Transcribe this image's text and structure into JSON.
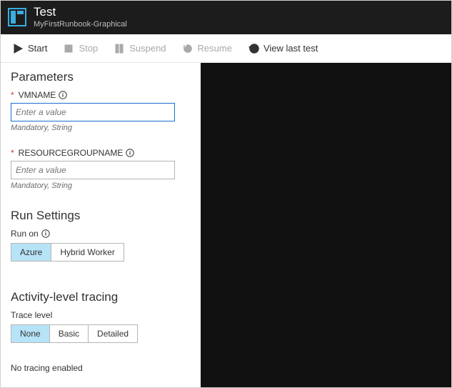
{
  "header": {
    "title": "Test",
    "subtitle": "MyFirstRunbook-Graphical"
  },
  "toolbar": {
    "start": "Start",
    "stop": "Stop",
    "suspend": "Suspend",
    "resume": "Resume",
    "view_last": "View last test"
  },
  "parameters": {
    "heading": "Parameters",
    "vmname": {
      "label": "VMNAME",
      "placeholder": "Enter a value",
      "hint": "Mandatory, String"
    },
    "rgname": {
      "label": "RESOURCEGROUPNAME",
      "placeholder": "Enter a value",
      "hint": "Mandatory, String"
    }
  },
  "run_settings": {
    "heading": "Run Settings",
    "label": "Run on",
    "options": {
      "azure": "Azure",
      "hybrid": "Hybrid Worker"
    },
    "selected": "azure"
  },
  "tracing": {
    "heading": "Activity-level tracing",
    "label": "Trace level",
    "options": {
      "none": "None",
      "basic": "Basic",
      "detailed": "Detailed"
    },
    "selected": "none",
    "message": "No tracing enabled"
  }
}
